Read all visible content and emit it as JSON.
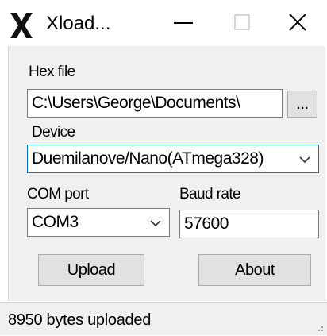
{
  "window": {
    "title": "Xload..."
  },
  "hex_file": {
    "label": "Hex file",
    "value": "C:\\Users\\George\\Documents\\",
    "browse_label": "..."
  },
  "device": {
    "label": "Device",
    "selected": "Duemilanove/Nano(ATmega328)"
  },
  "com_port": {
    "label": "COM port",
    "selected": "COM3"
  },
  "baud_rate": {
    "label": "Baud rate",
    "value": "57600"
  },
  "buttons": {
    "upload": "Upload",
    "about": "About"
  },
  "status": {
    "text": "8950 bytes uploaded"
  },
  "colors": {
    "focus_border": "#0078d7",
    "client_bg": "#f0f0f0",
    "button_bg": "#e1e1e1"
  },
  "icons": [
    "x-logo-icon",
    "minimize-icon",
    "maximize-icon",
    "close-icon",
    "chevron-down-icon",
    "size-grip-icon"
  ]
}
